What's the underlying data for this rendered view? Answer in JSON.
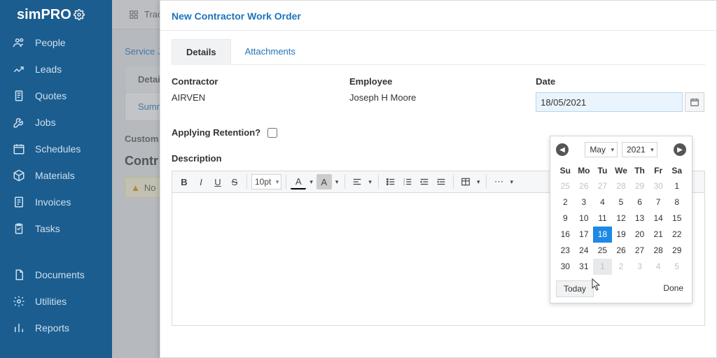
{
  "brand": {
    "name": "simPRO"
  },
  "sidebar": {
    "items": [
      {
        "label": "People",
        "icon": "people-icon"
      },
      {
        "label": "Leads",
        "icon": "leads-icon"
      },
      {
        "label": "Quotes",
        "icon": "quotes-icon"
      },
      {
        "label": "Jobs",
        "icon": "jobs-icon"
      },
      {
        "label": "Schedules",
        "icon": "schedules-icon"
      },
      {
        "label": "Materials",
        "icon": "materials-icon"
      },
      {
        "label": "Invoices",
        "icon": "invoices-icon"
      },
      {
        "label": "Tasks",
        "icon": "tasks-icon"
      }
    ],
    "items2": [
      {
        "label": "Documents",
        "icon": "documents-icon"
      },
      {
        "label": "Utilities",
        "icon": "utilities-icon"
      },
      {
        "label": "Reports",
        "icon": "reports-icon"
      }
    ]
  },
  "background": {
    "topbar_text": "Trad",
    "breadcrumb": "Service Jo",
    "tab_label": "Details",
    "subtab_label": "Summ",
    "customer_label": "Custom",
    "contractor_heading": "Contr",
    "note_text": "No"
  },
  "modal": {
    "title": "New Contractor Work Order",
    "tabs": [
      {
        "label": "Details",
        "active": true
      },
      {
        "label": "Attachments",
        "active": false
      }
    ],
    "contractor": {
      "label": "Contractor",
      "value": "AIRVEN"
    },
    "employee": {
      "label": "Employee",
      "value": "Joseph H Moore"
    },
    "date": {
      "label": "Date",
      "value": "18/05/2021"
    },
    "applying_retention_label": "Applying Retention?",
    "applying_retention_checked": false,
    "description_label": "Description",
    "editor": {
      "font_size": "10pt"
    }
  },
  "datepicker": {
    "month": "May",
    "year": "2021",
    "dow": [
      "Su",
      "Mo",
      "Tu",
      "We",
      "Th",
      "Fr",
      "Sa"
    ],
    "weeks": [
      [
        {
          "d": "25",
          "o": true
        },
        {
          "d": "26",
          "o": true
        },
        {
          "d": "27",
          "o": true
        },
        {
          "d": "28",
          "o": true
        },
        {
          "d": "29",
          "o": true
        },
        {
          "d": "30",
          "o": true
        },
        {
          "d": "1"
        }
      ],
      [
        {
          "d": "2"
        },
        {
          "d": "3"
        },
        {
          "d": "4"
        },
        {
          "d": "5"
        },
        {
          "d": "6"
        },
        {
          "d": "7"
        },
        {
          "d": "8"
        }
      ],
      [
        {
          "d": "9"
        },
        {
          "d": "10"
        },
        {
          "d": "11"
        },
        {
          "d": "12"
        },
        {
          "d": "13"
        },
        {
          "d": "14"
        },
        {
          "d": "15"
        }
      ],
      [
        {
          "d": "16"
        },
        {
          "d": "17"
        },
        {
          "d": "18",
          "sel": true
        },
        {
          "d": "19"
        },
        {
          "d": "20"
        },
        {
          "d": "21"
        },
        {
          "d": "22"
        }
      ],
      [
        {
          "d": "23"
        },
        {
          "d": "24"
        },
        {
          "d": "25"
        },
        {
          "d": "26"
        },
        {
          "d": "27"
        },
        {
          "d": "28"
        },
        {
          "d": "29"
        }
      ],
      [
        {
          "d": "30"
        },
        {
          "d": "31"
        },
        {
          "d": "1",
          "o": true,
          "hover": true
        },
        {
          "d": "2",
          "o": true
        },
        {
          "d": "3",
          "o": true
        },
        {
          "d": "4",
          "o": true
        },
        {
          "d": "5",
          "o": true
        }
      ]
    ],
    "today_label": "Today",
    "done_label": "Done"
  }
}
